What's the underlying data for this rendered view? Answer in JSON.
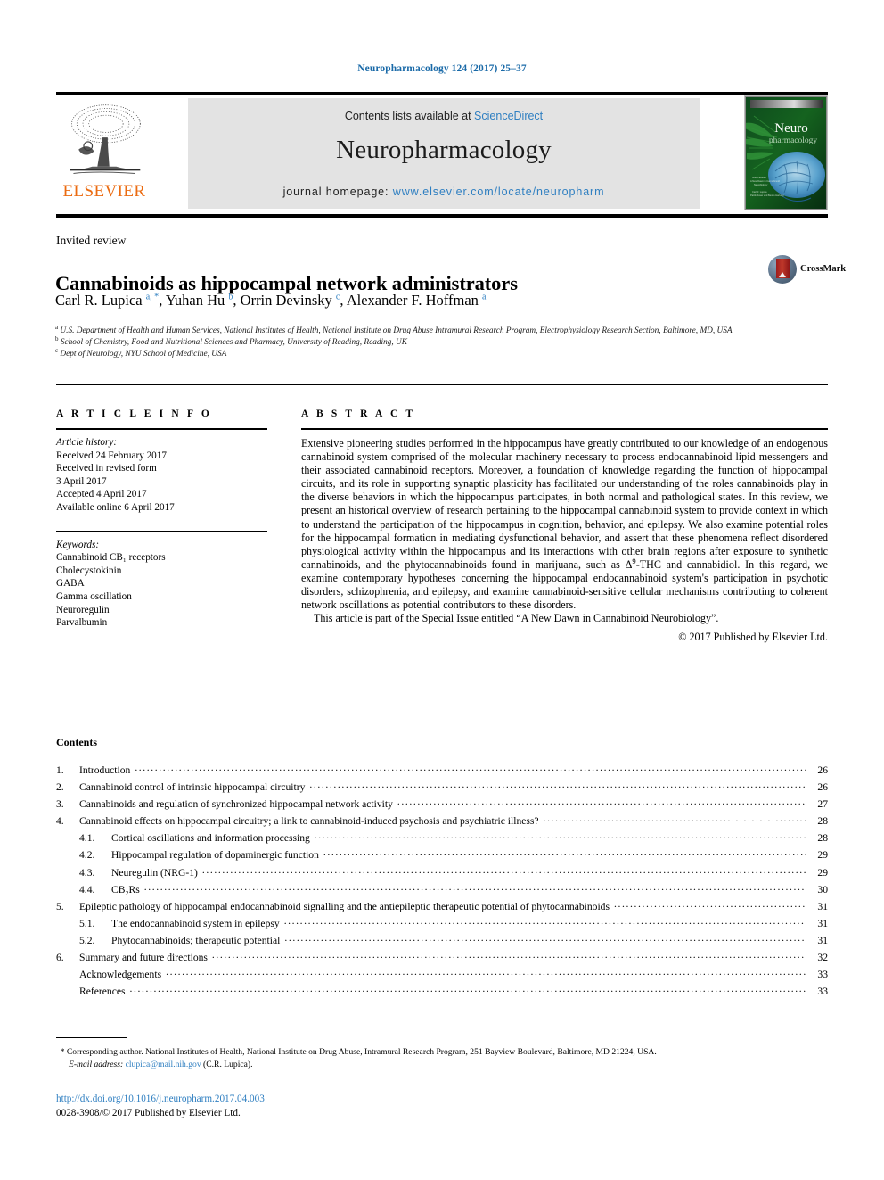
{
  "running_head": "Neuropharmacology 124 (2017) 25–37",
  "masthead": {
    "publisher_logo_text": "ELSEVIER",
    "contents_prefix": "Contents lists available at ",
    "contents_link": "ScienceDirect",
    "journal_title": "Neuropharmacology",
    "homepage_prefix": "journal homepage: ",
    "homepage_url": "www.elsevier.com/locate/neuropharm",
    "cover_title_line1": "Neuro",
    "cover_title_line2": "pharmacology"
  },
  "article": {
    "type_label": "Invited review",
    "title": "Cannabinoids as hippocampal network administrators",
    "authors": [
      {
        "name": "Carl R. Lupica",
        "marks": "a, *"
      },
      {
        "name": "Yuhan Hu",
        "marks": "b"
      },
      {
        "name": "Orrin Devinsky",
        "marks": "c"
      },
      {
        "name": "Alexander F. Hoffman",
        "marks": "a"
      }
    ],
    "affiliations": [
      {
        "mark": "a",
        "text": "U.S. Department of Health and Human Services, National Institutes of Health, National Institute on Drug Abuse Intramural Research Program, Electrophysiology Research Section, Baltimore, MD, USA"
      },
      {
        "mark": "b",
        "text": "School of Chemistry, Food and Nutritional Sciences and Pharmacy, University of Reading, Reading, UK"
      },
      {
        "mark": "c",
        "text": "Dept of Neurology, NYU School of Medicine, USA"
      }
    ],
    "crossmark_label": "CrossMark"
  },
  "article_info": {
    "heading": "A R T I C L E  I N F O",
    "history_label": "Article history:",
    "history": [
      "Received 24 February 2017",
      "Received in revised form",
      "3 April 2017",
      "Accepted 4 April 2017",
      "Available online 6 April 2017"
    ],
    "keywords_label": "Keywords:",
    "keywords": [
      "Cannabinoid CB₁ receptors",
      "Cholecystokinin",
      "GABA",
      "Gamma oscillation",
      "Neuroregulin",
      "Parvalbumin"
    ]
  },
  "abstract": {
    "heading": "A B S T R A C T",
    "body": "Extensive pioneering studies performed in the hippocampus have greatly contributed to our knowledge of an endogenous cannabinoid system comprised of the molecular machinery necessary to process endocannabinoid lipid messengers and their associated cannabinoid receptors. Moreover, a foundation of knowledge regarding the function of hippocampal circuits, and its role in supporting synaptic plasticity has facilitated our understanding of the roles cannabinoids play in the diverse behaviors in which the hippocampus participates, in both normal and pathological states. In this review, we present an historical overview of research pertaining to the hippocampal cannabinoid system to provide context in which to understand the participation of the hippocampus in cognition, behavior, and epilepsy. We also examine potential roles for the hippocampal formation in mediating dysfunctional behavior, and assert that these phenomena reflect disordered physiological activity within the hippocampus and its interactions with other brain regions after exposure to synthetic cannabinoids, and the phytocannabinoids found in marijuana, such as Δ9-THC and cannabidiol. In this regard, we examine contemporary hypotheses concerning the hippocampal endocannabinoid system's participation in psychotic disorders, schizophrenia, and epilepsy, and examine cannabinoid-sensitive cellular mechanisms contributing to coherent network oscillations as potential contributors to these disorders.",
    "special_issue": "This article is part of the Special Issue entitled “A New Dawn in Cannabinoid Neurobiology”.",
    "copyright": "© 2017 Published by Elsevier Ltd."
  },
  "contents": {
    "heading": "Contents",
    "entries": [
      {
        "num": "1.",
        "label": "Introduction",
        "page": "26",
        "level": 1
      },
      {
        "num": "2.",
        "label": "Cannabinoid control of intrinsic hippocampal circuitry",
        "page": "26",
        "level": 1
      },
      {
        "num": "3.",
        "label": "Cannabinoids and regulation of synchronized hippocampal network activity",
        "page": "27",
        "level": 1
      },
      {
        "num": "4.",
        "label": "Cannabinoid effects on hippocampal circuitry; a link to cannabinoid-induced psychosis and psychiatric illness?",
        "page": "28",
        "level": 1
      },
      {
        "num": "4.1.",
        "label": "Cortical oscillations and information processing",
        "page": "28",
        "level": 2
      },
      {
        "num": "4.2.",
        "label": "Hippocampal regulation of dopaminergic function",
        "page": "29",
        "level": 2
      },
      {
        "num": "4.3.",
        "label": "Neuregulin (NRG-1)",
        "page": "29",
        "level": 2
      },
      {
        "num": "4.4.",
        "label": "CB₂Rs",
        "page": "30",
        "level": 2
      },
      {
        "num": "5.",
        "label": "Epileptic pathology of hippocampal endocannabinoid signalling and the antiepileptic therapeutic potential of phytocannabinoids",
        "page": "31",
        "level": 1
      },
      {
        "num": "5.1.",
        "label": "The endocannabinoid system in epilepsy",
        "page": "31",
        "level": 2
      },
      {
        "num": "5.2.",
        "label": "Phytocannabinoids; therapeutic potential",
        "page": "31",
        "level": 2
      },
      {
        "num": "6.",
        "label": "Summary and future directions",
        "page": "32",
        "level": 1
      },
      {
        "num": "",
        "label": "Acknowledgements",
        "page": "33",
        "level": 3
      },
      {
        "num": "",
        "label": "References",
        "page": "33",
        "level": 3
      }
    ]
  },
  "footer": {
    "corresponding_star": "*",
    "corresponding_text": " Corresponding author. National Institutes of Health, National Institute on Drug Abuse, Intramural Research Program, 251 Bayview Boulevard, Baltimore, MD 21224, USA.",
    "email_label": "E-mail address:",
    "email": "clupica@mail.nih.gov",
    "email_owner": "(C.R. Lupica).",
    "doi": "http://dx.doi.org/10.1016/j.neuropharm.2017.04.003",
    "issn_line": "0028-3908/© 2017 Published by Elsevier Ltd."
  },
  "colors": {
    "link_blue": "#2f7fc1",
    "header_blue": "#1a6aa8",
    "elsevier_orange": "#eb6b11",
    "band_gray": "#e3e3e3"
  }
}
